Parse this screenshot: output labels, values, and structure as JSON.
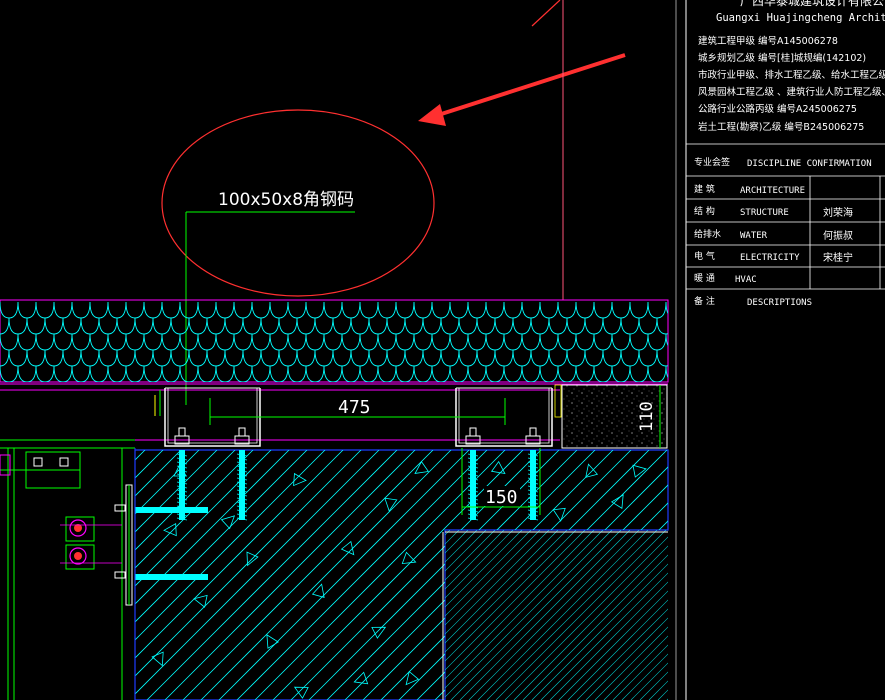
{
  "colors": {
    "background": "#000000",
    "cyan": "#00ffff",
    "green": "#00ff00",
    "magenta": "#ff00ff",
    "white": "#ffffff",
    "red": "#ff3030",
    "blue": "#1e3cff",
    "pink": "#ff5577",
    "gray": "#9a9a9a"
  },
  "annotation": {
    "label": "100x50x8角钢码"
  },
  "dimensions": {
    "span": "475",
    "bolt_spacing": "150",
    "height": "110"
  },
  "title_block": {
    "company_line_cn": "广西华泰城建筑设计有限公司",
    "company_line_en": "Guangxi Huajingcheng Architectural Design",
    "cert_lines": [
      "建筑工程甲级 编号A145006278",
      "城乡规划乙级 编号[桂]城规编(142102)",
      "市政行业甲级、排水工程乙级、给水工程乙级、",
      "风景园林工程乙级 、建筑行业人防工程乙级、",
      "公路行业公路丙级 编号A245006275",
      "岩土工程(勘察)乙级 编号B245006275"
    ],
    "section_header": {
      "cn": "专业会签",
      "en": "DISCIPLINE CONFIRMATION"
    },
    "rows": [
      {
        "cn": "建 筑",
        "en": "ARCHITECTURE",
        "signer": ""
      },
      {
        "cn": "结 构",
        "en": "STRUCTURE",
        "signer": "刘荣海"
      },
      {
        "cn": "给排水",
        "en": "WATER",
        "signer": "何振叔"
      },
      {
        "cn": "电 气",
        "en": "ELECTRICITY",
        "signer": "宋桂宁"
      },
      {
        "cn": "暖 通",
        "en": "HVAC",
        "signer": ""
      },
      {
        "cn": "备 注",
        "en": "DESCRIPTIONS",
        "signer": ""
      }
    ]
  }
}
